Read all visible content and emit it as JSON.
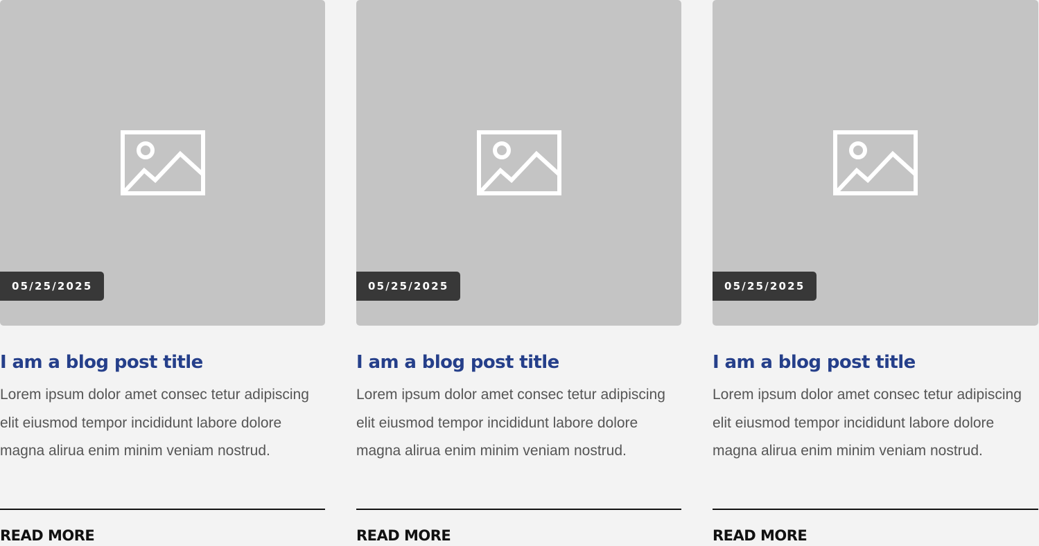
{
  "colors": {
    "page_background": "#f3f3f3",
    "image_placeholder": "#c4c4c4",
    "date_badge_background": "#383838",
    "title": "#253f8a",
    "excerpt": "#555555",
    "divider": "#111111"
  },
  "posts": [
    {
      "image_icon": "image-placeholder-icon",
      "date": "05/25/2025",
      "title": "I am a blog post title",
      "excerpt": "Lorem ipsum dolor amet consec tetur adipiscing elit eiusmod tempor incididunt labore dolore magna alirua enim minim veniam nostrud.",
      "read_more": "READ MORE"
    },
    {
      "image_icon": "image-placeholder-icon",
      "date": "05/25/2025",
      "title": "I am a blog post title",
      "excerpt": "Lorem ipsum dolor amet consec tetur adipiscing elit eiusmod tempor incididunt labore dolore magna alirua enim minim veniam nostrud.",
      "read_more": "READ MORE"
    },
    {
      "image_icon": "image-placeholder-icon",
      "date": "05/25/2025",
      "title": "I am a blog post title",
      "excerpt": "Lorem ipsum dolor amet consec tetur adipiscing elit eiusmod tempor incididunt labore dolore magna alirua enim minim veniam nostrud.",
      "read_more": "READ MORE"
    }
  ]
}
